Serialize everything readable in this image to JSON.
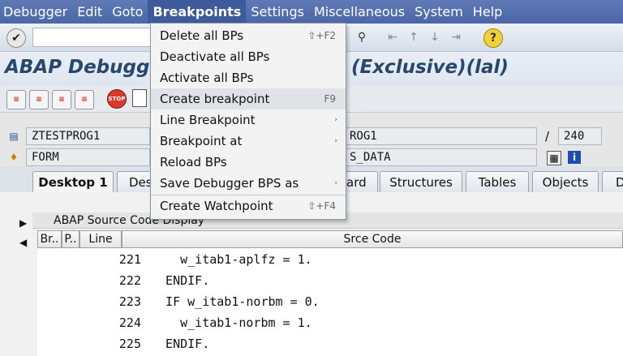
{
  "menubar": {
    "items": [
      "Debugger",
      "Edit",
      "Goto",
      "Breakpoints",
      "Settings",
      "Miscellaneous",
      "System",
      "Help"
    ]
  },
  "title": {
    "left": "ABAP Debugger",
    "right": "(Exclusive)(lal)"
  },
  "fields": {
    "program": "ZTESTPROG1",
    "program_right": "ROG1",
    "line": "240",
    "line_sep": "/",
    "event_type": "FORM",
    "event_right": "S_DATA"
  },
  "tabs": [
    "Desktop 1",
    "Des",
    "ard",
    "Structures",
    "Tables",
    "Objects",
    "D"
  ],
  "source_panel": {
    "title": "ABAP Source Code Display",
    "columns": [
      "Br..",
      "P..",
      "Line",
      "Srce Code"
    ],
    "rows": [
      {
        "line": "221",
        "code": "    w_itab1-aplfz = 1."
      },
      {
        "line": "222",
        "code": "  ENDIF."
      },
      {
        "line": "223",
        "code": "  IF w_itab1-norbm = 0."
      },
      {
        "line": "224",
        "code": "    w_itab1-norbm = 1."
      },
      {
        "line": "225",
        "code": "  ENDIF."
      }
    ]
  },
  "breakpoints_menu": {
    "items": [
      {
        "label": "Delete all BPs",
        "shortcut": "⇧+F2"
      },
      {
        "label": "Deactivate all BPs",
        "shortcut": ""
      },
      {
        "label": "Activate all BPs",
        "shortcut": ""
      },
      {
        "label": "Create breakpoint",
        "shortcut": "F9"
      },
      {
        "label": "Line Breakpoint",
        "shortcut": "›"
      },
      {
        "label": "Breakpoint at",
        "shortcut": "›"
      },
      {
        "label": "Reload BPs",
        "shortcut": ""
      },
      {
        "label": "Save Debugger BPS as",
        "shortcut": "›"
      },
      {
        "label": "Create Watchpoint",
        "shortcut": "⇧+F4"
      }
    ]
  },
  "icons": {
    "ok": "checkmark-icon",
    "help": "help-icon",
    "stop": "stop-icon",
    "stop_text": "STOP"
  }
}
